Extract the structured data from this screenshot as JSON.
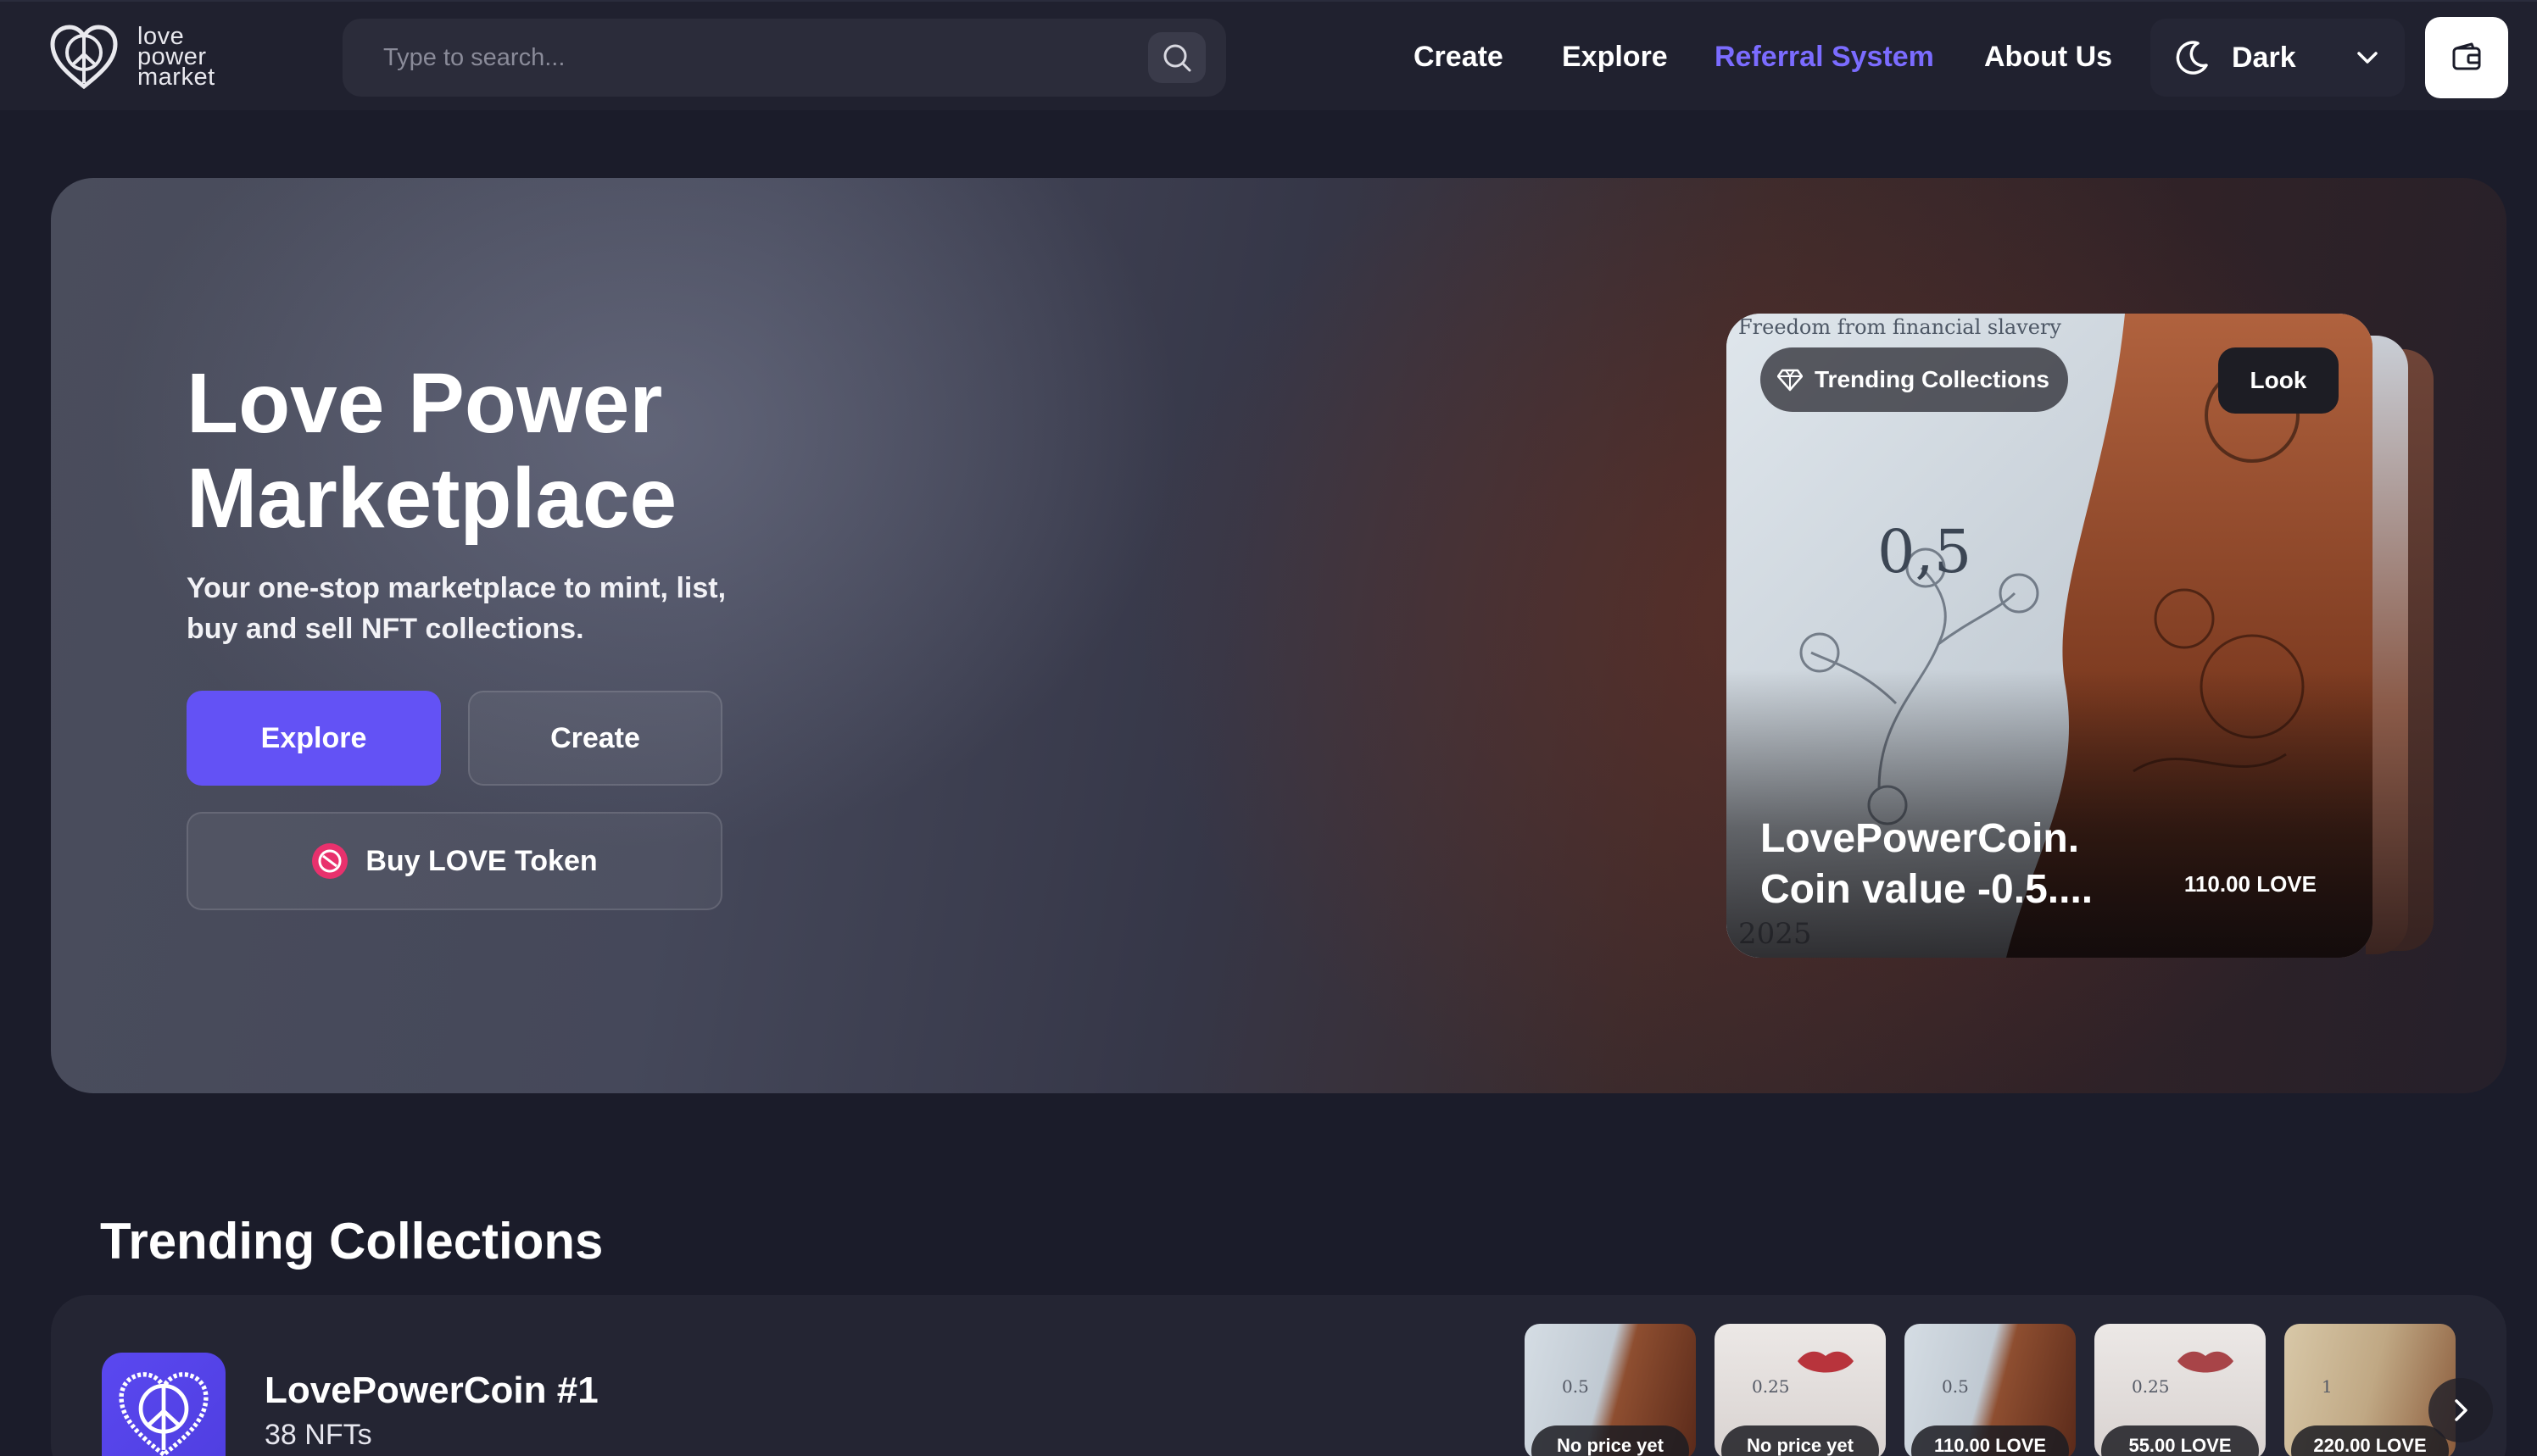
{
  "header": {
    "logo_lines": [
      "love",
      "power",
      "market"
    ],
    "search_placeholder": "Type to search...",
    "nav": [
      {
        "label": "Create",
        "active": false
      },
      {
        "label": "Explore",
        "active": false
      },
      {
        "label": "Referral System",
        "active": true
      },
      {
        "label": "About Us",
        "active": false
      }
    ],
    "theme_label": "Dark"
  },
  "hero": {
    "title": "Love Power\nMarketplace",
    "subtitle": "Your one-stop marketplace to mint, list, buy and sell NFT collections.",
    "explore_label": "Explore",
    "create_label": "Create",
    "buy_token_label": "Buy LOVE Token"
  },
  "featured": {
    "badge": "Trending Collections",
    "look_label": "Look",
    "title": "LovePowerCoin. Coin value -0.5....",
    "price": "110.00 LOVE",
    "art_text_top": "Freedom from financial slavery",
    "art_value": "0,5",
    "art_year": "2025"
  },
  "trending": {
    "section_title": "Trending Collections",
    "collection": {
      "name": "LovePowerCoin #1",
      "count": "38 NFTs"
    },
    "thumbs": [
      {
        "price": "No price yet",
        "value": "0.5",
        "style": "coin"
      },
      {
        "price": "No price yet",
        "value": "0.25",
        "style": "lips"
      },
      {
        "price": "110.00 LOVE",
        "value": "0.5",
        "style": "coin"
      },
      {
        "price": "55.00 LOVE",
        "value": "0.25",
        "style": "lips"
      },
      {
        "price": "220.00 LOVE",
        "value": "1",
        "style": "gold"
      }
    ]
  },
  "colors": {
    "accent": "#6352f5",
    "active_link": "#7b6cff",
    "background": "#1b1c2a",
    "header": "#20212f"
  }
}
